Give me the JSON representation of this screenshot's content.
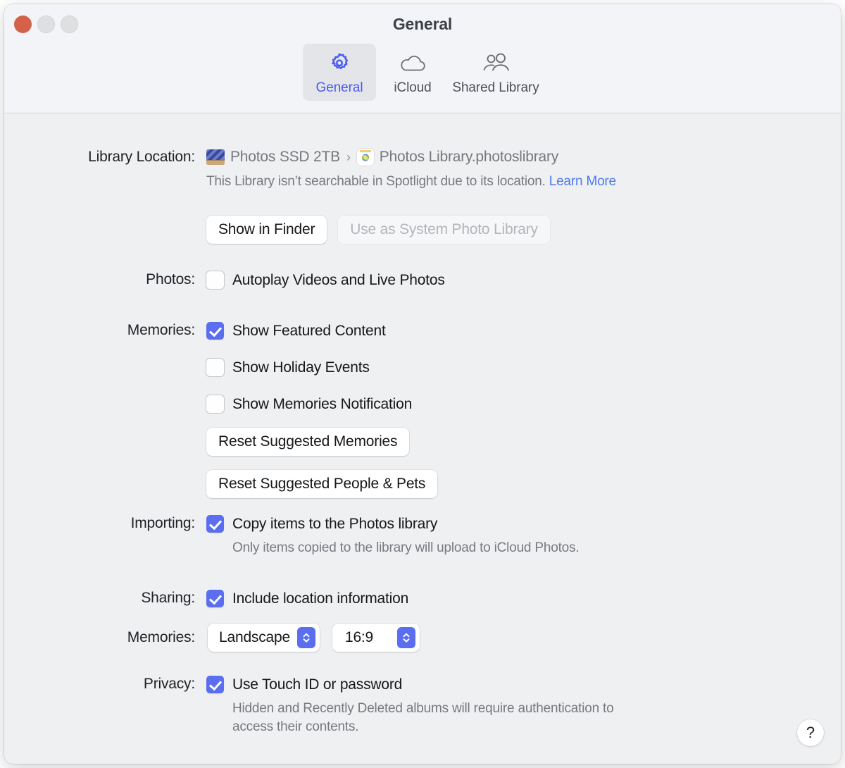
{
  "window": {
    "title": "General",
    "traffic_lights": [
      "close",
      "minimize",
      "zoom"
    ]
  },
  "toolbar": {
    "tabs": [
      {
        "label": "General",
        "icon": "gear-icon",
        "selected": true
      },
      {
        "label": "iCloud",
        "icon": "cloud-icon",
        "selected": false
      },
      {
        "label": "Shared Library",
        "icon": "people-icon",
        "selected": false
      }
    ]
  },
  "library_location": {
    "label": "Library Location:",
    "drive_name": "Photos SSD 2TB",
    "separator": "›",
    "library_name": "Photos Library.photoslibrary",
    "note": "This Library isn’t searchable in Spotlight due to its location.",
    "learn_more": "Learn More",
    "show_in_finder_button": "Show in Finder",
    "use_as_system_button": "Use as System Photo Library",
    "use_as_system_enabled": false
  },
  "photos": {
    "label": "Photos:",
    "autoplay": {
      "text": "Autoplay Videos and Live Photos",
      "checked": false
    }
  },
  "memories": {
    "label": "Memories:",
    "show_featured": {
      "text": "Show Featured Content",
      "checked": true
    },
    "show_holiday": {
      "text": "Show Holiday Events",
      "checked": false
    },
    "show_notification": {
      "text": "Show Memories Notification",
      "checked": false
    },
    "reset_memories_button": "Reset Suggested Memories",
    "reset_people_button": "Reset Suggested People & Pets"
  },
  "importing": {
    "label": "Importing:",
    "copy_items": {
      "text": "Copy items to the Photos library",
      "checked": true
    },
    "note": "Only items copied to the library will upload to iCloud Photos."
  },
  "sharing": {
    "label": "Sharing:",
    "include_location": {
      "text": "Include location information",
      "checked": true
    },
    "memories_label": "Memories:",
    "orientation_value": "Landscape",
    "aspect_value": "16:9"
  },
  "privacy": {
    "label": "Privacy:",
    "touch_id": {
      "text": "Use Touch ID or password",
      "checked": true
    },
    "note_line1": "Hidden and Recently Deleted albums will require authentication to",
    "note_line2": "access their contents."
  },
  "help": {
    "glyph": "?"
  },
  "colors": {
    "accent_blue": "#5b6ef0",
    "link_blue": "#4d79f0",
    "window_bg": "#eff0f2",
    "toolbar_bg": "#f2f4f7",
    "close_red": "#d4614a"
  }
}
